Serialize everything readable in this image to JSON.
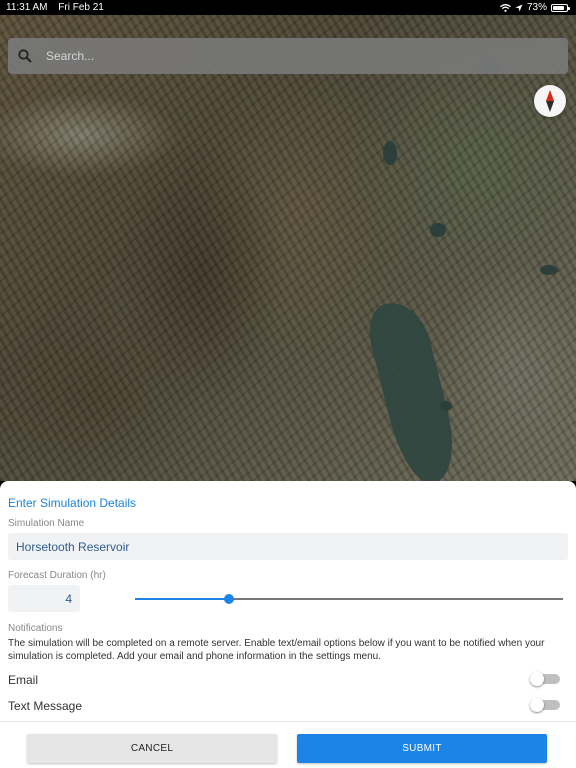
{
  "status_bar": {
    "time": "11:31 AM",
    "date": "Fri Feb 21",
    "battery": "73%",
    "icons": [
      "wifi-icon",
      "location-arrow-icon",
      "battery-icon"
    ]
  },
  "search": {
    "placeholder": "Search...",
    "icon": "search-icon"
  },
  "map": {
    "compass_icon": "compass-icon"
  },
  "sheet": {
    "title": "Enter Simulation Details",
    "simulation_name": {
      "label": "Simulation Name",
      "value": "Horsetooth Reservoir"
    },
    "forecast_duration": {
      "label": "Forecast Duration (hr)",
      "value": "4",
      "slider_fraction": 0.22
    },
    "notifications": {
      "label": "Notifications",
      "description": "The simulation will be completed on a remote server. Enable text/email options below if you want to be notified when your simulation is completed. Add your email and phone information in the settings menu."
    },
    "email_toggle": {
      "label": "Email",
      "on": false
    },
    "text_toggle": {
      "label": "Text Message",
      "on": false
    },
    "cancel_label": "CANCEL",
    "submit_label": "SUBMIT"
  },
  "colors": {
    "accent": "#1c84e6",
    "title": "#1c84d6",
    "input_text": "#2d5c8f"
  }
}
